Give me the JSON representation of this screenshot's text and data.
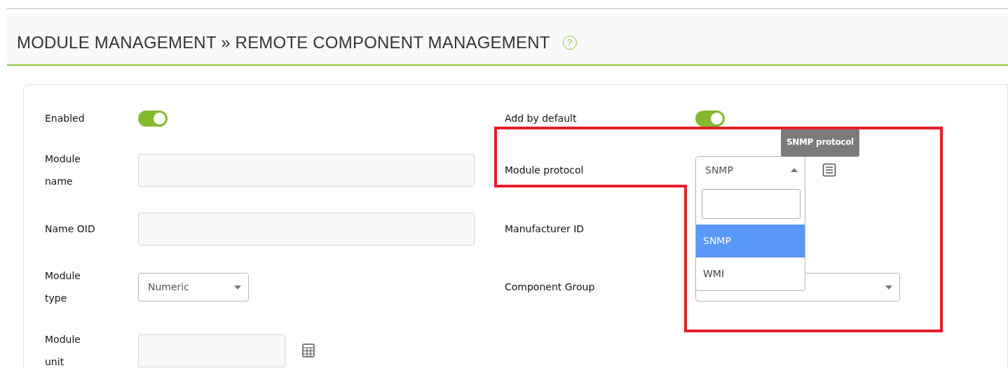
{
  "header": {
    "title": "MODULE MANAGEMENT » REMOTE COMPONENT MANAGEMENT",
    "help": "?"
  },
  "rows": [
    {
      "left": {
        "label": "Enabled",
        "kind": "toggle",
        "on": true
      },
      "right": {
        "label": "Add by default",
        "kind": "toggle",
        "on": true
      }
    },
    {
      "left": {
        "label": "Module name",
        "kind": "text"
      },
      "right": {
        "label": "Module protocol",
        "kind": "select",
        "value": "SNMP",
        "expanded": true,
        "icon": true,
        "tooltip": "SNMP protocol",
        "options": [
          {
            "label": "SNMP",
            "selected": true
          },
          {
            "label": "WMI",
            "selected": false
          }
        ]
      }
    },
    {
      "left": {
        "label": "Name OID",
        "kind": "text"
      },
      "right": {
        "label": "Manufacturer ID",
        "kind": "hidden"
      }
    },
    {
      "left": {
        "label": "Module type",
        "kind": "select",
        "value": "Numeric",
        "expanded": false
      },
      "right": {
        "label": "Component Group",
        "kind": "select",
        "expanded": false
      }
    },
    {
      "left": {
        "label": "Module unit",
        "kind": "text",
        "icon": true
      }
    }
  ]
}
